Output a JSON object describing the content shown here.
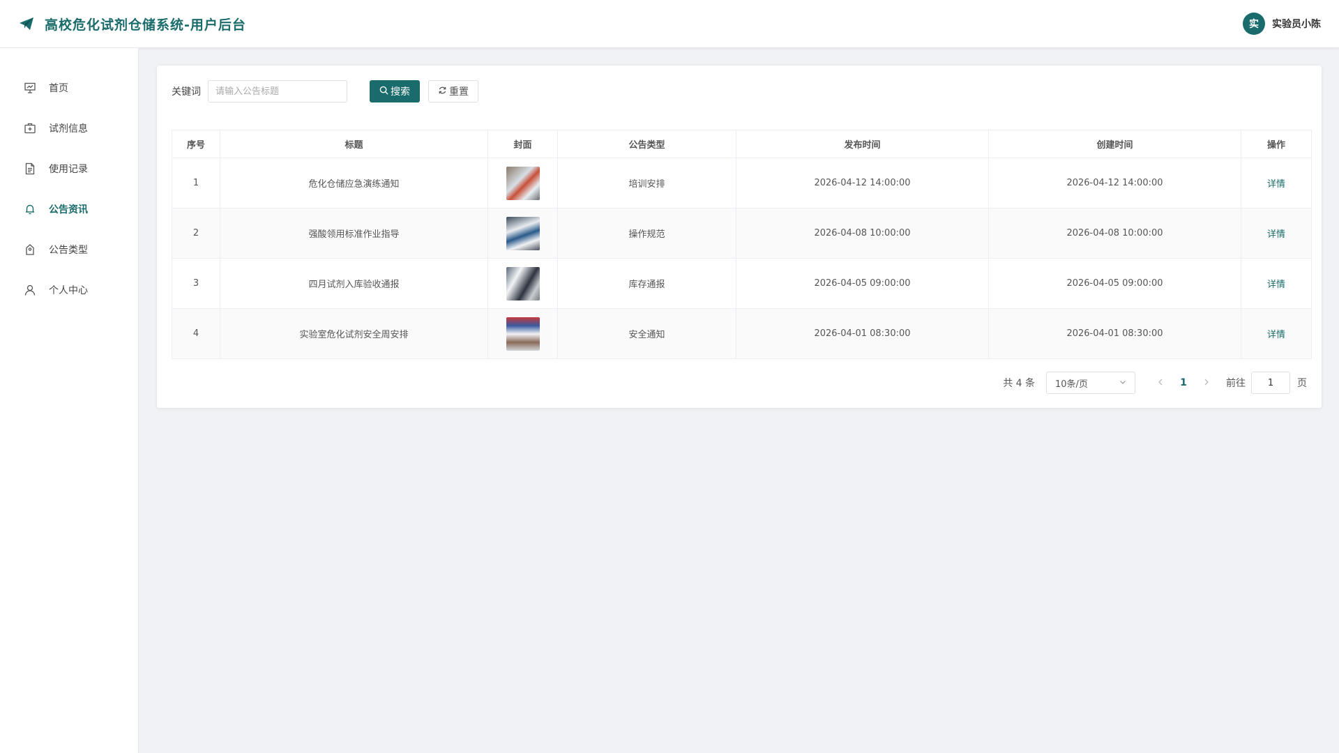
{
  "header": {
    "title": "高校危化试剂仓储系统-用户后台",
    "user": {
      "avatar_text": "实",
      "name": "实验员小陈"
    }
  },
  "sidebar": {
    "items": [
      {
        "label": "首页",
        "icon": "presentation-icon",
        "active": false
      },
      {
        "label": "试剂信息",
        "icon": "medkit-icon",
        "active": false
      },
      {
        "label": "使用记录",
        "icon": "document-icon",
        "active": false
      },
      {
        "label": "公告资讯",
        "icon": "bell-icon",
        "active": true
      },
      {
        "label": "公告类型",
        "icon": "tag-icon",
        "active": false
      },
      {
        "label": "个人中心",
        "icon": "user-icon",
        "active": false
      }
    ]
  },
  "filter": {
    "keyword_label": "关键词",
    "keyword_value": "",
    "keyword_placeholder": "请输入公告标题",
    "search_label": "搜索",
    "reset_label": "重置"
  },
  "table": {
    "columns": [
      "序号",
      "标题",
      "封面",
      "公告类型",
      "发布时间",
      "创建时间",
      "操作"
    ],
    "rows": [
      {
        "index": "1",
        "title": "危化仓储应急演练通知",
        "type": "培训安排",
        "publish_time": "2026-04-12 14:00:00",
        "create_time": "2026-04-12 14:00:00",
        "action": "详情"
      },
      {
        "index": "2",
        "title": "强酸领用标准作业指导",
        "type": "操作规范",
        "publish_time": "2026-04-08 10:00:00",
        "create_time": "2026-04-08 10:00:00",
        "action": "详情"
      },
      {
        "index": "3",
        "title": "四月试剂入库验收通报",
        "type": "库存通报",
        "publish_time": "2026-04-05 09:00:00",
        "create_time": "2026-04-05 09:00:00",
        "action": "详情"
      },
      {
        "index": "4",
        "title": "实验室危化试剂安全周安排",
        "type": "安全通知",
        "publish_time": "2026-04-01 08:30:00",
        "create_time": "2026-04-01 08:30:00",
        "action": "详情"
      }
    ]
  },
  "pagination": {
    "total": "共 4 条",
    "page_size": "10条/页",
    "current_page": "1",
    "goto_label": "前往",
    "goto_value": "1",
    "page_suffix": "页"
  },
  "colors": {
    "accent": "#1a6b6b"
  }
}
